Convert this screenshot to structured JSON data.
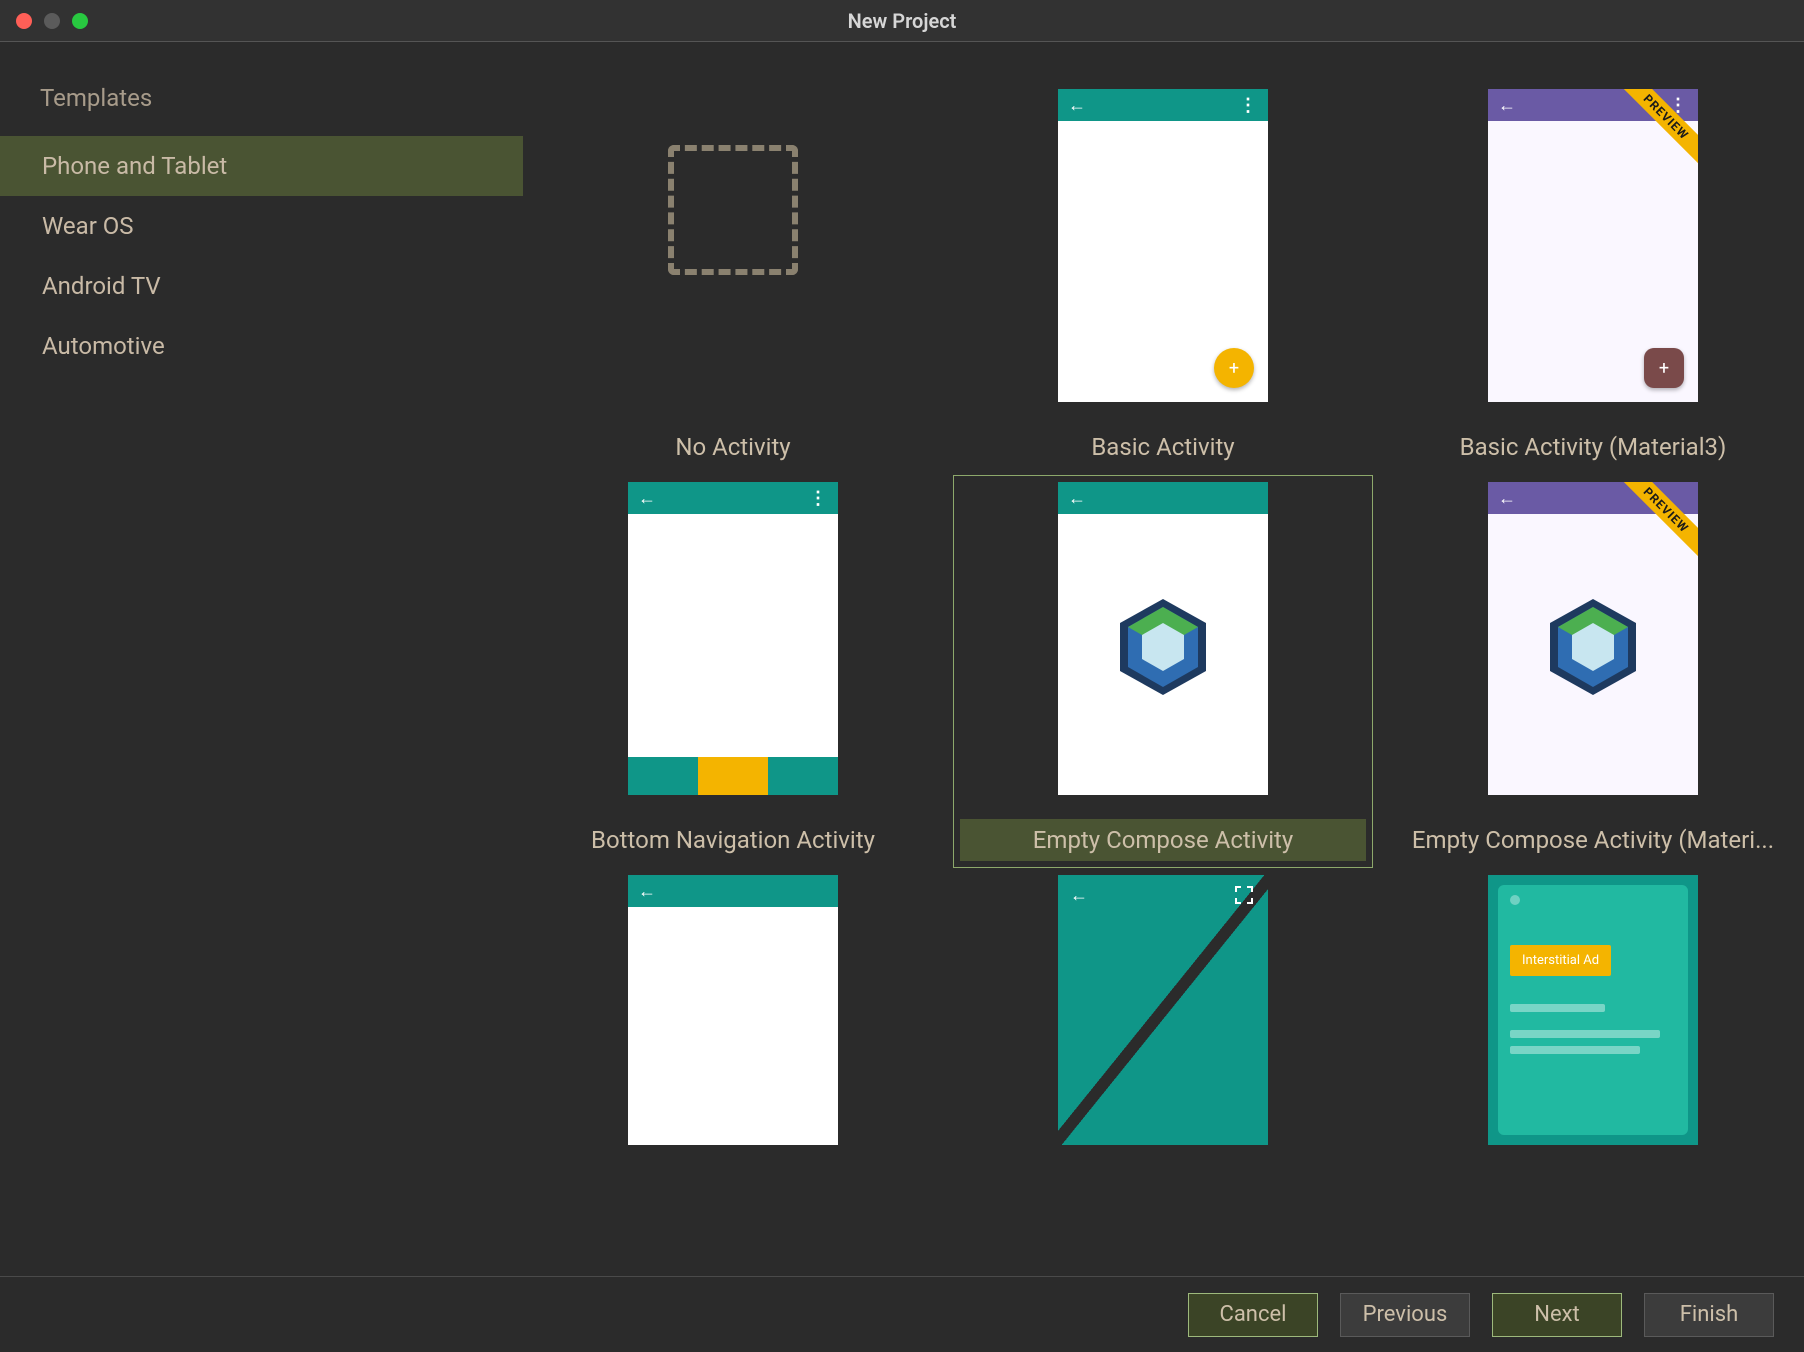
{
  "window": {
    "title": "New Project"
  },
  "sidebar": {
    "heading": "Templates",
    "items": [
      {
        "label": "Phone and Tablet",
        "selected": true
      },
      {
        "label": "Wear OS",
        "selected": false
      },
      {
        "label": "Android TV",
        "selected": false
      },
      {
        "label": "Automotive",
        "selected": false
      }
    ]
  },
  "templates": [
    {
      "label": "No Activity",
      "kind": "none",
      "selected": false
    },
    {
      "label": "Basic Activity",
      "kind": "basic_teal",
      "selected": false
    },
    {
      "label": "Basic Activity (Material3)",
      "kind": "basic_purple_preview",
      "selected": false
    },
    {
      "label": "Bottom Navigation Activity",
      "kind": "bottom_nav",
      "selected": false
    },
    {
      "label": "Empty Compose Activity",
      "kind": "compose_teal",
      "selected": true
    },
    {
      "label": "Empty Compose Activity (Materi...",
      "kind": "compose_purple_preview",
      "selected": false
    },
    {
      "label": "",
      "kind": "empty_teal",
      "selected": false
    },
    {
      "label": "",
      "kind": "fullscreen",
      "selected": false
    },
    {
      "label": "",
      "kind": "ads",
      "selected": false
    }
  ],
  "ribbon_text": "PREVIEW",
  "ad_button_text": "Interstitial Ad",
  "footer": {
    "cancel": "Cancel",
    "previous": "Previous",
    "next": "Next",
    "finish": "Finish"
  },
  "colors": {
    "teal": "#0f9688",
    "teal_light": "#21b9a1",
    "purple": "#6a5aa5",
    "amber": "#f4b400",
    "selection": "#4a5433",
    "selection_border": "#8da86b"
  }
}
